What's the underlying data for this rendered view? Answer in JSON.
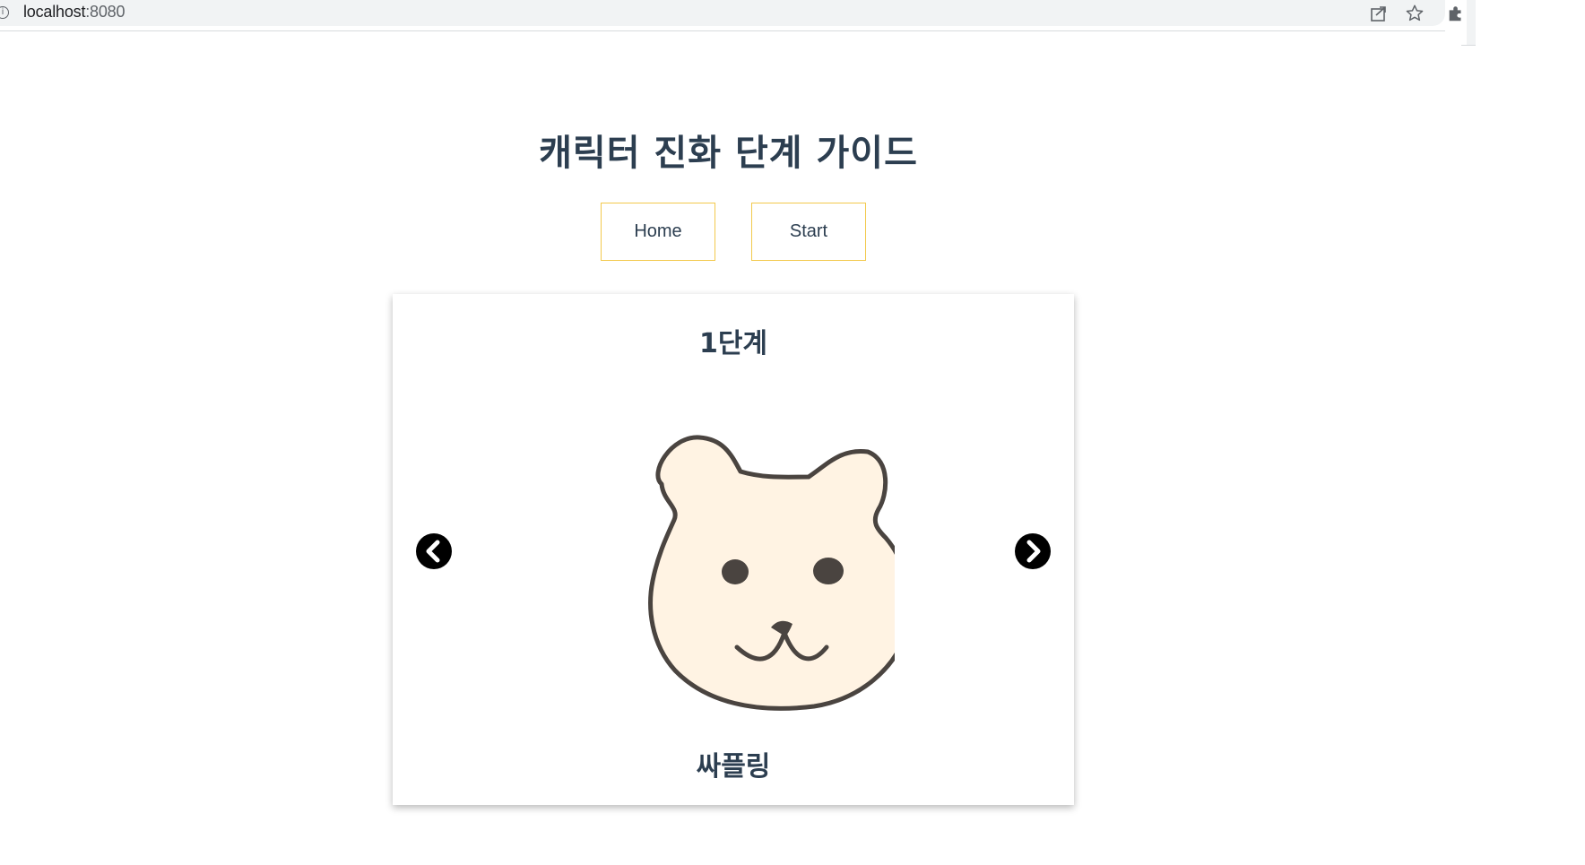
{
  "browser": {
    "info_symbol": "i",
    "url_host": "localhost",
    "url_port": ":8080"
  },
  "page": {
    "title": "캐릭터 진화 단계 가이드"
  },
  "nav": {
    "home_label": "Home",
    "start_label": "Start"
  },
  "carousel": {
    "stage_title": "1단계",
    "character_name": "싸플링",
    "image": "bear-face-illustration",
    "prev_icon": "chevron-left-circle-icon",
    "next_icon": "chevron-right-circle-icon"
  },
  "colors": {
    "title_text": "#2c3e50",
    "button_border": "#f2c94c",
    "bear_fill": "#fff3e3",
    "bear_outline": "#4a4440"
  }
}
